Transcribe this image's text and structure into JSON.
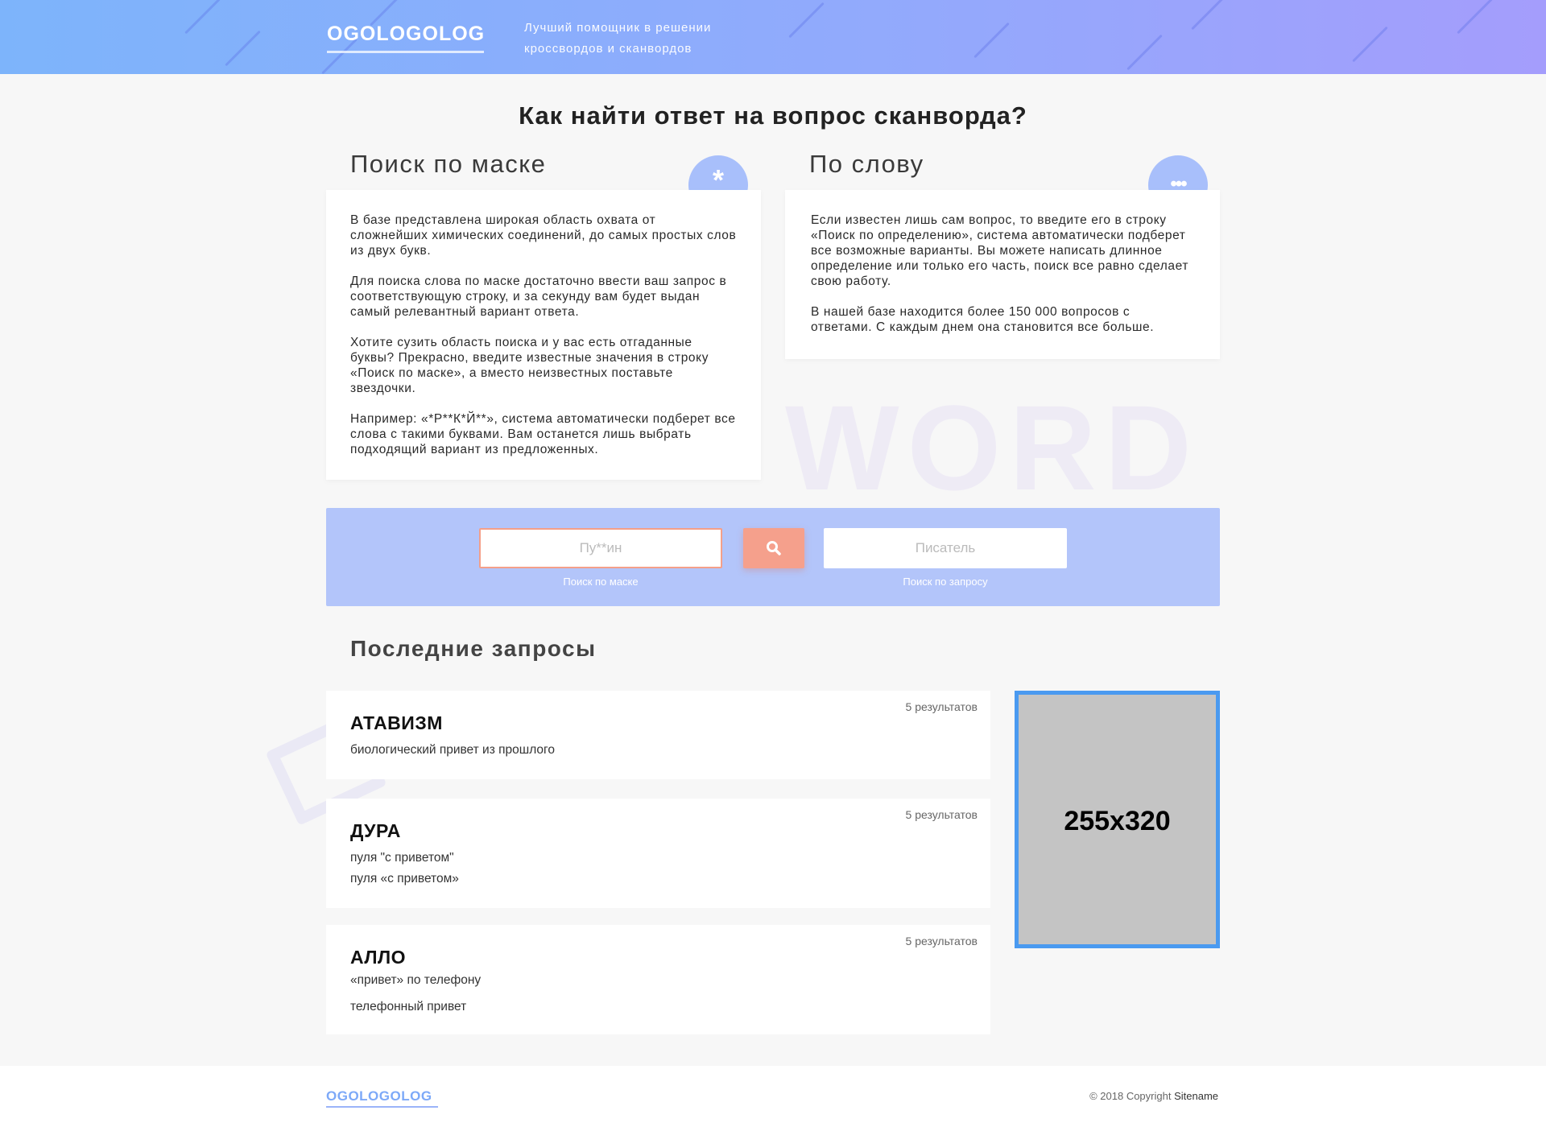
{
  "header": {
    "logo": "OGOLOGOLOG",
    "tagline_1": "Лучший помощник в решении",
    "tagline_2": "кроссвордов и сканвордов"
  },
  "main_title": "Как найти ответ на вопрос сканворда?",
  "mask_section": {
    "title": "Поиск по маске",
    "icon_glyph": "*",
    "paragraphs": [
      "В базе представлена широкая область охвата от сложнейших химических соединений, до самых простых слов из двух букв.",
      "Для поиска слова по маске достаточно ввести ваш запрос в соответствующую строку, и за секунду вам будет выдан самый релевантный вариант ответа.",
      "Хотите сузить область поиска и у вас есть отгаданные буквы? Прекрасно, введите известные значения в строку «Поиск по маске», а вместо неизвестных поставьте звездочки.",
      "Например: «*Р**К*Й**», система автоматически подберет все слова с такими буквами. Вам останется лишь выбрать подходящий вариант из предложенных."
    ]
  },
  "word_section": {
    "title": "По слову",
    "icon_glyph": "•••",
    "paragraphs": [
      "Если известен лишь сам вопрос, то введите его в строку «Поиск по определению», система автоматически подберет все возможные варианты. Вы можете написать длинное определение или только его часть, поиск все равно сделает свою работу.",
      "В нашей базе находится более 150 000 вопросов с ответами. С каждым днем она становится все больше."
    ],
    "watermark": "WORD"
  },
  "search": {
    "mask_placeholder": "Пу**ин",
    "mask_caption": "Поиск по маске",
    "word_placeholder": "Писатель",
    "word_caption": "Поиск по запросу"
  },
  "recent": {
    "title": "Последние запросы",
    "items": [
      {
        "word": "АТАВИЗМ",
        "count": "5 результатов",
        "lines": [
          "биологический привет из прошлого"
        ]
      },
      {
        "word": "ДУРА",
        "count": "5 результатов",
        "lines": [
          "пуля \"с приветом\"",
          "пуля «с приветом»"
        ]
      },
      {
        "word": "АЛЛО",
        "count": "5 результатов",
        "lines": [
          "«привет» по телефону",
          "телефонный привет"
        ]
      }
    ]
  },
  "ad": {
    "label": "255x320"
  },
  "footer": {
    "logo": "OGOLOGOLOG",
    "copyright": "© 2018 Copyright",
    "sitename": "Sitename"
  },
  "colors": {
    "header_gradient_start": "#7db4fb",
    "header_gradient_end": "#a49dfc",
    "search_band": "#b3c5fa",
    "accent_button": "#f5a08c",
    "ad_border": "#4a9af0"
  }
}
